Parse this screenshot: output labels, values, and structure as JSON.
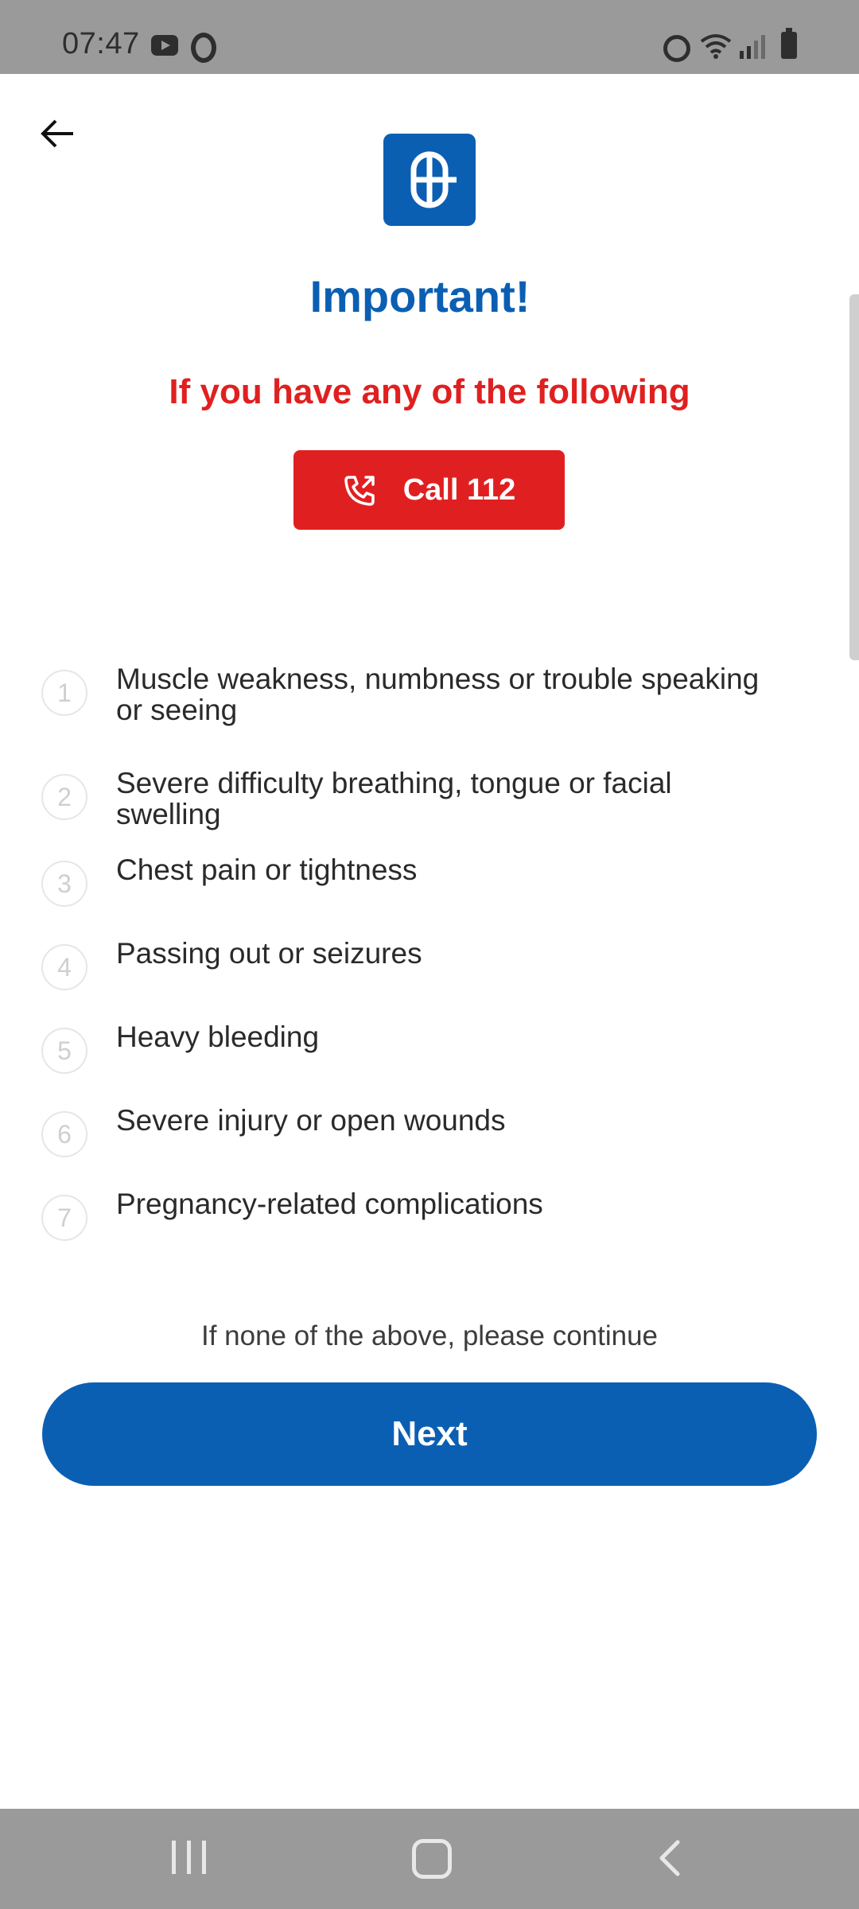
{
  "status_bar": {
    "time": "07:47",
    "left_icons": [
      "youtube-icon",
      "opera-icon"
    ],
    "right_icons": [
      "alarm-icon",
      "wifi-icon",
      "signal-icon",
      "battery-icon"
    ]
  },
  "header": {
    "back_icon": "arrow-left-icon",
    "logo_icon": "brand-logo"
  },
  "title": "Important!",
  "subtitle": "If you have any of the following",
  "call_button": {
    "icon": "phone-outgoing-icon",
    "label": "Call 112"
  },
  "symptoms": [
    {
      "number": "1",
      "text": "Muscle weakness, numbness or trouble speaking or seeing"
    },
    {
      "number": "2",
      "text": "Severe difficulty breathing, tongue or facial swelling"
    },
    {
      "number": "3",
      "text": "Chest pain or tightness"
    },
    {
      "number": "4",
      "text": "Passing out or seizures"
    },
    {
      "number": "5",
      "text": "Heavy bleeding"
    },
    {
      "number": "6",
      "text": "Severe injury or open wounds"
    },
    {
      "number": "7",
      "text": "Pregnancy-related complications"
    }
  ],
  "hint": "If none of the above, please continue",
  "next_button": {
    "label": "Next"
  },
  "nav_bar": {
    "icons": [
      "recents-icon",
      "home-icon",
      "back-icon"
    ]
  },
  "colors": {
    "brand_blue": "#0b5fb3",
    "alert_red": "#e02020",
    "status_bar_bg": "#9a9a9a"
  }
}
